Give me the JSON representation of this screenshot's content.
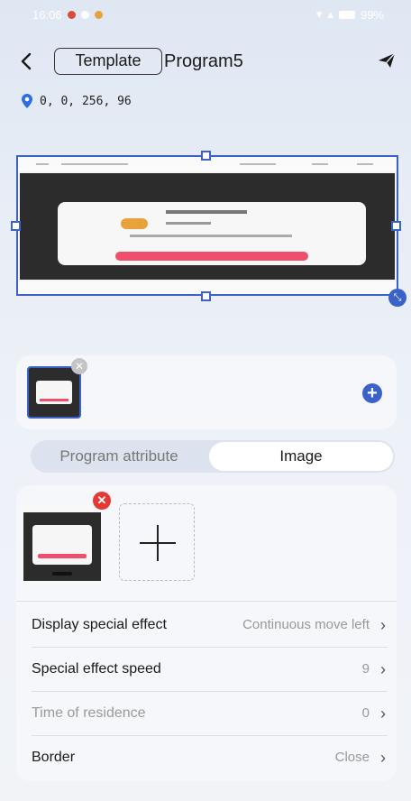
{
  "status_bar": {
    "time": "16:06",
    "battery": "99%"
  },
  "header": {
    "back_icon": "chevron-left-icon",
    "template_label": "Template",
    "title": "Program5",
    "send_icon": "send-icon"
  },
  "location": {
    "icon": "location-pin-icon",
    "coords": "0, 0, 256, 96"
  },
  "colors": {
    "accent": "#3a62c9",
    "remove_red": "#e53935",
    "preview_button": "#ef4f6c"
  },
  "tabs": [
    {
      "label": "Program attribute",
      "selected": false
    },
    {
      "label": "Image",
      "selected": true
    }
  ],
  "settings": [
    {
      "label": "Display special effect",
      "value": "Continuous move left",
      "enabled": true
    },
    {
      "label": "Special effect speed",
      "value": "9",
      "enabled": true
    },
    {
      "label": "Time of residence",
      "value": "0",
      "enabled": false
    },
    {
      "label": "Border",
      "value": "Close",
      "enabled": true
    }
  ]
}
